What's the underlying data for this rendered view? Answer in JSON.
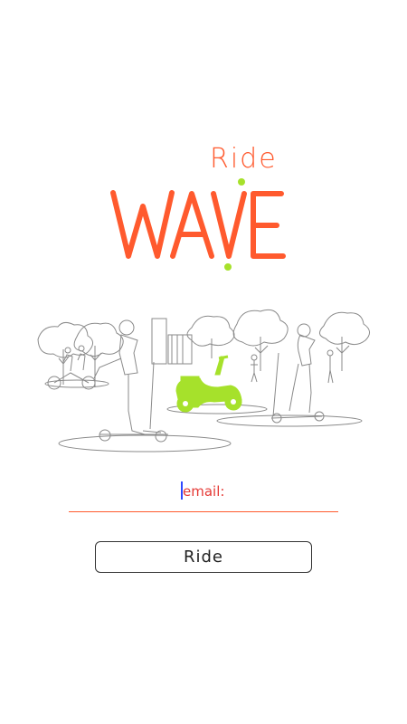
{
  "logo": {
    "top_word": "Ride",
    "main_word": "WAVE",
    "colors": {
      "brand": "#FF5A2E",
      "accent": "#A6E12B"
    }
  },
  "illustration": {
    "description_icon": "city-scooter-riders-illustration-icon",
    "colors": {
      "scooter": "#A6E12B",
      "line": "#8A8A8A"
    }
  },
  "form": {
    "email_label": "email:",
    "email_value": "",
    "ride_label": "Ride"
  }
}
